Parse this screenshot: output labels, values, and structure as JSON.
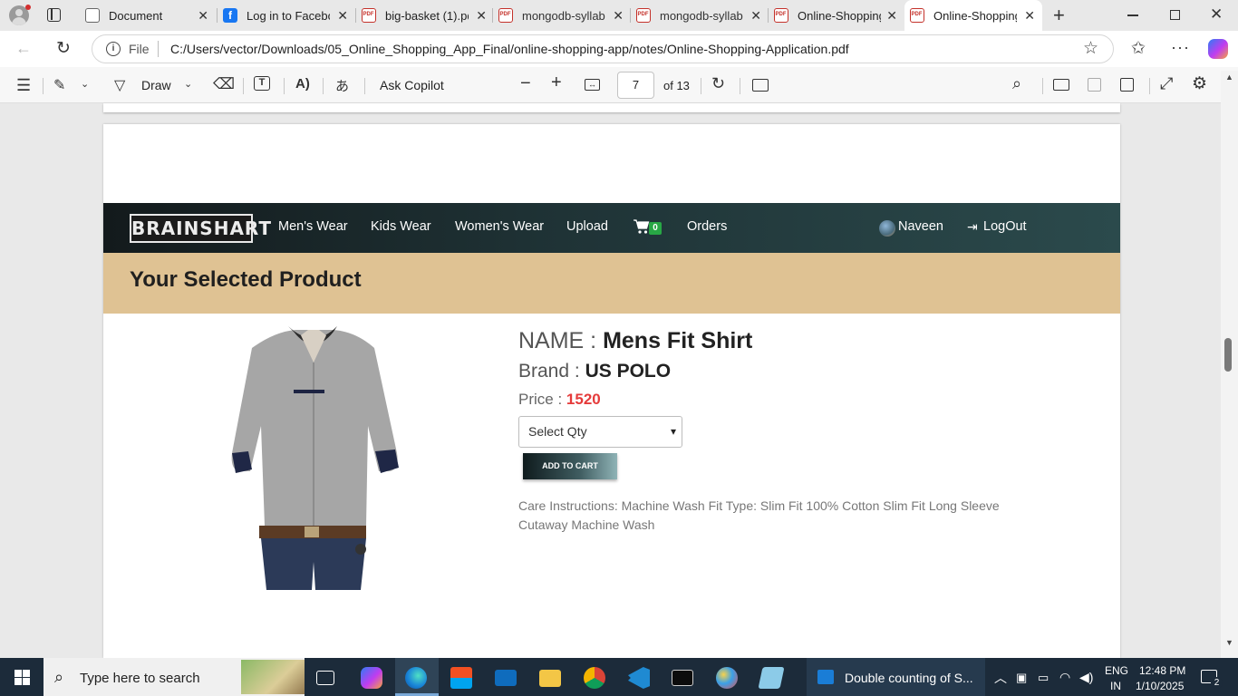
{
  "browser": {
    "tabs": [
      {
        "title": "Document",
        "icon": "globe-icon"
      },
      {
        "title": "Log in to Facebo",
        "icon": "facebook-icon"
      },
      {
        "title": "big-basket (1).pd",
        "icon": "pdf-icon"
      },
      {
        "title": "mongodb-syllab",
        "icon": "pdf-icon"
      },
      {
        "title": "mongodb-syllab",
        "icon": "pdf-icon"
      },
      {
        "title": "Online-Shopping",
        "icon": "pdf-icon"
      },
      {
        "title": "Online-Shopping",
        "icon": "pdf-icon",
        "active": true
      }
    ],
    "address": {
      "scheme_label": "File",
      "url": "C:/Users/vector/Downloads/05_Online_Shopping_App_Final/online-shopping-app/notes/Online-Shopping-Application.pdf"
    }
  },
  "pdf_toolbar": {
    "draw_label": "Draw",
    "copilot_label": "Ask Copilot",
    "page_current": "7",
    "page_total_label": "of 13"
  },
  "document": {
    "brand_logo": "BRAINSHART",
    "nav": {
      "links": [
        "Men's Wear",
        "Kids Wear",
        "Women's Wear",
        "Upload"
      ],
      "cart_count": "0",
      "orders": "Orders",
      "user": "Naveen",
      "logout": "LogOut"
    },
    "banner_title": "Your Selected Product",
    "product": {
      "name_label": "NAME :",
      "name": "Mens Fit Shirt",
      "brand_label": "Brand :",
      "brand": "US POLO",
      "price_label": "Price :",
      "price": "1520",
      "qty_placeholder": "Select Qty",
      "add_to_cart": "ADD TO CART",
      "description": "Care Instructions: Machine Wash Fit Type: Slim Fit 100% Cotton Slim Fit Long Sleeve Cutaway Machine Wash"
    }
  },
  "taskbar": {
    "search_placeholder": "Type here to search",
    "active_window": "Double counting of S...",
    "lang_top": "ENG",
    "lang_bottom": "IN",
    "time": "12:48 PM",
    "date": "1/10/2025",
    "notifications": "2"
  },
  "colors": {
    "price_red": "#e53b3b",
    "banner": "#dfc293",
    "taskbar": "#1c2b3a"
  }
}
